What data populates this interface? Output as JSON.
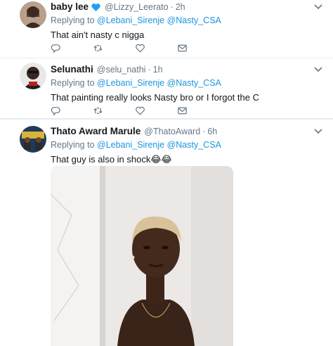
{
  "tweets": [
    {
      "name": "baby lee",
      "verified_emoji": true,
      "handle": "@Lizzy_Leerato",
      "time": "2h",
      "replying_prefix": "Replying to ",
      "mention1": "@Lebani_Sirenje",
      "mention2": "@Nasty_CSA",
      "text": "That ain't nasty c nigga"
    },
    {
      "name": "Selunathi",
      "handle": "@selu_nathi",
      "time": "1h",
      "replying_prefix": "Replying to ",
      "mention1": "@Lebani_Sirenje",
      "mention2": "@Nasty_CSA",
      "text": "That painting really looks Nasty bro or I forgot the C"
    },
    {
      "name": "Thato Award Marule",
      "handle": "@ThatoAward",
      "time": "6h",
      "replying_prefix": "Replying to ",
      "mention1": "@Lebani_Sirenje",
      "mention2": "@Nasty_CSA",
      "text": "That guy is also in shock😂😂"
    }
  ],
  "separator": "·",
  "icons": [
    "reply-icon",
    "retweet-icon",
    "like-icon",
    "message-icon",
    "caret-down-icon"
  ],
  "colors": {
    "link": "#1b95e0",
    "muted": "#657786",
    "text": "#14171a",
    "verified": "#1da1f2"
  }
}
